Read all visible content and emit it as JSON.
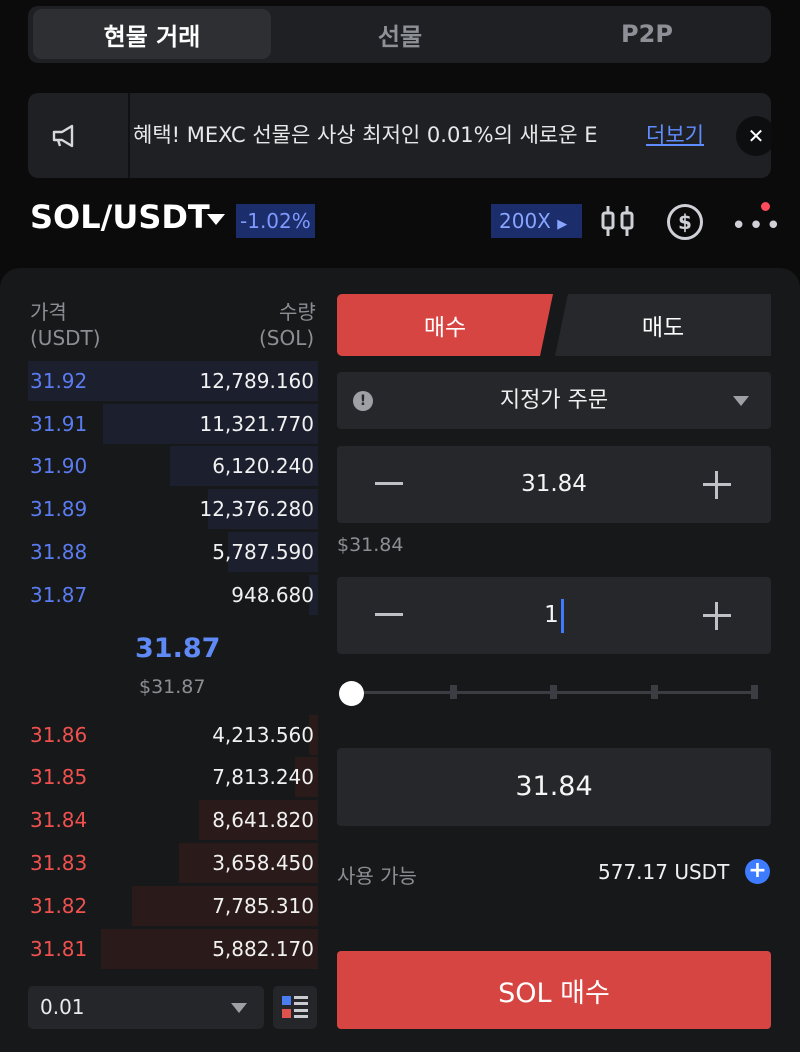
{
  "top_tabs": [
    {
      "label": "현물 거래",
      "active": true
    },
    {
      "label": "선물",
      "active": false
    },
    {
      "label": "P2P",
      "active": false
    }
  ],
  "notice": {
    "text": "혜택! MEXC 선물은 사상 최저인 0.01%의 새로운 E",
    "more_label": "더보기",
    "close_label": "✕"
  },
  "pair": {
    "symbol": "SOL/USDT",
    "change": "-1.02%",
    "leverage": "200X"
  },
  "orderbook": {
    "price_header": "가격",
    "price_unit": "(USDT)",
    "qty_header": "수량",
    "qty_unit": "(SOL)",
    "asks": [
      {
        "price": "31.92",
        "qty": "12,789.160",
        "depth": 1.0
      },
      {
        "price": "31.91",
        "qty": "11,321.770",
        "depth": 0.74
      },
      {
        "price": "31.90",
        "qty": "6,120.240",
        "depth": 0.51
      },
      {
        "price": "31.89",
        "qty": "12,376.280",
        "depth": 0.38
      },
      {
        "price": "31.88",
        "qty": "5,787.590",
        "depth": 0.31
      },
      {
        "price": "31.87",
        "qty": "948.680",
        "depth": 0.03
      }
    ],
    "mid_price": "31.87",
    "mid_price_usd": "$31.87",
    "bids": [
      {
        "price": "31.86",
        "qty": "4,213.560",
        "depth": 0.03
      },
      {
        "price": "31.85",
        "qty": "7,813.240",
        "depth": 0.08
      },
      {
        "price": "31.84",
        "qty": "8,641.820",
        "depth": 0.41
      },
      {
        "price": "31.83",
        "qty": "3,658.450",
        "depth": 0.48
      },
      {
        "price": "31.82",
        "qty": "7,785.310",
        "depth": 0.64
      },
      {
        "price": "31.81",
        "qty": "5,882.170",
        "depth": 0.75
      }
    ],
    "depth_value": "0.01"
  },
  "order_form": {
    "buy_tab": "매수",
    "sell_tab": "매도",
    "order_type": "지정가 주문",
    "price": "31.84",
    "price_usd": "$31.84",
    "amount": "1",
    "slider_level": 0,
    "total": "31.84",
    "available_label": "사용 가능",
    "available_value": "577.17 USDT",
    "submit_label": "SOL 매수"
  },
  "colors": {
    "buy": "#d64541",
    "ask_price": "#5b7cf0",
    "bid_price": "#f0514f",
    "accent": "#3d7bff"
  }
}
